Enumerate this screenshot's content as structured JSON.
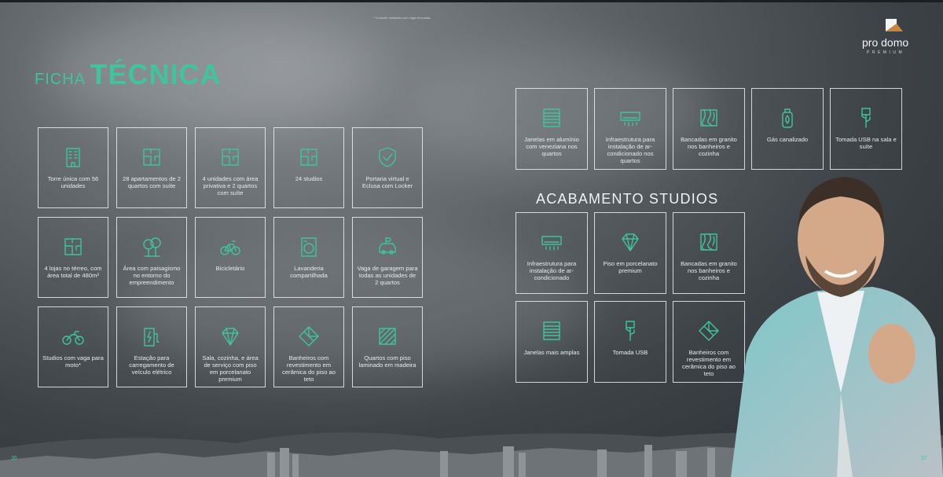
{
  "footnote": "* Consulte unidades com vaga vinculada.",
  "title": {
    "part1": "FICHA",
    "part2": "TÉCNICA"
  },
  "logo": {
    "name": "pro domo",
    "tagline": "PREMIUM"
  },
  "section_title": "ACABAMENTO STUDIOS",
  "page_left": "36",
  "page_right": "37",
  "colors": {
    "accent": "#3fc49b",
    "text": "#e6ebee"
  },
  "features": [
    {
      "icon": "building-icon",
      "label": "Torre única com 56 unidades"
    },
    {
      "icon": "floorplan-icon",
      "label": "28 apartamentos de 2 quartos com suíte"
    },
    {
      "icon": "floorplan-icon",
      "label": "4 unidades com área privativa e 2 quartos com suíte"
    },
    {
      "icon": "floorplan-icon",
      "label": "24 studios"
    },
    {
      "icon": "shield-check-icon",
      "label": "Portaria virtual e Eclusa com Locker"
    },
    {
      "icon": "floorplan-icon",
      "label": "4 lojas no térreo, com área total de 480m²"
    },
    {
      "icon": "tree-icon",
      "label": "Área com paisagismo no entorno do empreendimento"
    },
    {
      "icon": "bicycle-icon",
      "label": "Bicicletário"
    },
    {
      "icon": "laundry-icon",
      "label": "Lavanderia compartilhada"
    },
    {
      "icon": "car-parking-icon",
      "label": "Vaga de garagem para todas as unidades de 2 quartos"
    },
    {
      "icon": "motorcycle-icon",
      "label": "Studios com vaga para moto*"
    },
    {
      "icon": "ev-charger-icon",
      "label": "Estação para carregamento de veículo elétrico"
    },
    {
      "icon": "diamond-icon",
      "label": "Sala, cozinha, e área de serviço com piso em porcelanato premium"
    },
    {
      "icon": "tile-icon",
      "label": "Banheiros com revestimento em cerâmica do piso ao teto"
    },
    {
      "icon": "wood-floor-icon",
      "label": "Quartos com piso laminado em madeira"
    }
  ],
  "finishes": [
    {
      "icon": "window-blind-icon",
      "label": "Janelas em alumínio com veneziana nos quartos"
    },
    {
      "icon": "air-conditioner-icon",
      "label": "Infraestrutura para instalação de ar-condicionado nos quartos"
    },
    {
      "icon": "granite-icon",
      "label": "Bancadas em granito nos banheiros e cozinha"
    },
    {
      "icon": "gas-icon",
      "label": "Gás canalizado"
    },
    {
      "icon": "usb-icon",
      "label": "Tomada USB na sala e suíte"
    }
  ],
  "studio_finishes": [
    {
      "icon": "air-conditioner-icon",
      "label": "Infraestrutura para instalação de ar-condicionado"
    },
    {
      "icon": "diamond-icon",
      "label": "Piso em porcelanato premium"
    },
    {
      "icon": "granite-icon",
      "label": "Bancadas em granito nos banheiros e cozinha"
    },
    {
      "icon": "window-blind-icon",
      "label": "Janelas mais amplas"
    },
    {
      "icon": "usb-icon",
      "label": "Tomada USB"
    },
    {
      "icon": "tile-icon",
      "label": "Banheiros com revestimento em cerâmica do piso ao teto"
    }
  ]
}
